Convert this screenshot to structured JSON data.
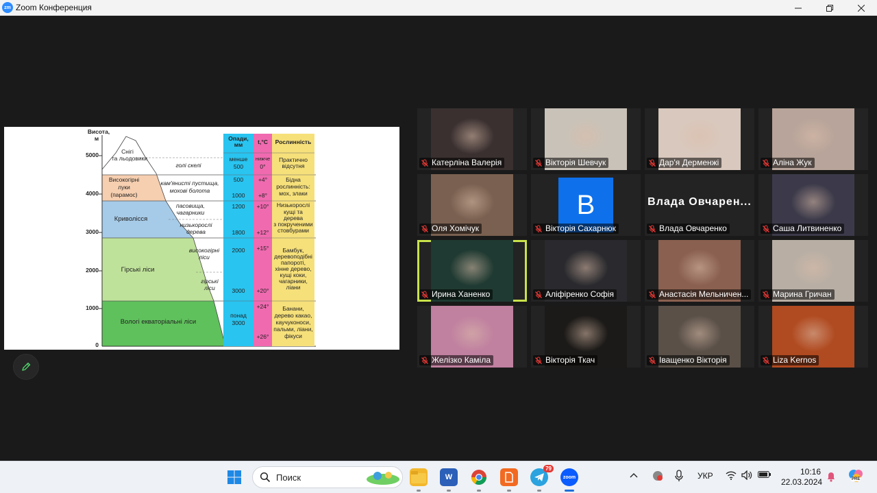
{
  "window": {
    "title": "Zoom Конференция",
    "logo_text": "zm"
  },
  "slide": {
    "height_axis_title": "Висота,",
    "height_axis_unit": "м",
    "height_ticks": [
      "5000",
      "4000",
      "3000",
      "2000",
      "1000",
      "0"
    ],
    "headers": {
      "precip": "Опади,",
      "precip_unit": "мм",
      "temp": "t,°C",
      "vegetation": "Рослинність"
    },
    "zones": [
      {
        "name": "Снігі",
        "name2": "та льодовики",
        "sub": "голі скелі",
        "precip_a": "менше",
        "precip_b": "500",
        "temp_a": "нижче",
        "temp_b": "0°",
        "veg": "Практично відсутня"
      },
      {
        "name": "Високогірні",
        "name2": "луки",
        "name3": "(парамос)",
        "sub": "кам'янисті пустища,",
        "sub2": "мохові болота",
        "precip_a": "500",
        "precip_b": "1000",
        "temp_a": "+4°",
        "temp_b": "+8°",
        "veg": "Бідна",
        "veg2": "рослинність:",
        "veg3": "мох, злаки"
      },
      {
        "name": "Криволісся",
        "sub": "пасовища,",
        "sub2": "чагарники",
        "sub3": "низькорослі",
        "sub4": "дерева",
        "precip_a": "1200",
        "precip_b": "1800",
        "temp_a": "+10°",
        "temp_b": "+12°",
        "veg": "Низькорослі",
        "veg2": "кущі та",
        "veg3": "дерева",
        "veg4": "з покрученими",
        "veg5": "стовбурами"
      },
      {
        "name": "Гірські ліси",
        "sub": "високогірні",
        "sub2": "ліси",
        "sub3": "гірські",
        "sub4": "ліси",
        "precip_a": "2000",
        "precip_b": "3000",
        "temp_a": "+15°",
        "temp_b": "+20°",
        "veg": "Бамбук,",
        "veg2": "деревоподібні",
        "veg3": "папороті,",
        "veg4": "хінне дерево,",
        "veg5": "кущі коки,",
        "veg6": "чагарники,",
        "veg7": "ліани"
      },
      {
        "name": "Вологі екваторіальні ліси",
        "precip_a": "понад",
        "precip_b": "3000",
        "temp_a": "+24°",
        "temp_b": "+26°",
        "veg": "Банани,",
        "veg2": "дерево какао,",
        "veg3": "каучуконоси,",
        "veg4": "пальми, ліани,",
        "veg5": "фікуси"
      }
    ]
  },
  "participants": [
    {
      "name": "Катерліна Валерія",
      "bg": "#3a3030",
      "active": false
    },
    {
      "name": "Вікторія Шевчук",
      "bg": "#c9c2b8",
      "active": false
    },
    {
      "name": "Дар'я Дерменжі",
      "bg": "#d9c8bd",
      "active": false
    },
    {
      "name": "Аліна Жук",
      "bg": "#b8a49a",
      "active": false
    },
    {
      "name": "Оля Хомічук",
      "bg": "#7a6050",
      "active": false
    },
    {
      "name": "Вікторія Сахарнюк",
      "bg": "#232323",
      "active": false,
      "avatar": "B"
    },
    {
      "name": "Влада Овчаренко",
      "bg": "#232323",
      "active": false,
      "bigname": "Влада Овчарен..."
    },
    {
      "name": "Саша Литвиненко",
      "bg": "#3c3a4a",
      "active": false
    },
    {
      "name": "Ирина Ханенко",
      "bg": "#1f3a32",
      "active": true
    },
    {
      "name": "Аліфіренко Софія",
      "bg": "#2a2a2e",
      "active": false
    },
    {
      "name": "Анастасія Мельничен...",
      "bg": "#8a6050",
      "active": false
    },
    {
      "name": "Марина Гричан",
      "bg": "#b8aea4",
      "active": false
    },
    {
      "name": "Желізко Каміла",
      "bg": "#c080a0",
      "active": false
    },
    {
      "name": "Вікторія Ткач",
      "bg": "#1c1a18",
      "active": false
    },
    {
      "name": "Іващенко Вікторія",
      "bg": "#5a5048",
      "active": false
    },
    {
      "name": "Liza Kernos",
      "bg": "#b04a20",
      "active": false
    }
  ],
  "taskbar": {
    "search_placeholder": "Поиск",
    "telegram_badge": "79",
    "lang": "УКР",
    "time": "10:16",
    "date": "22.03.2024",
    "zoom_label": "zoom",
    "copilot_badge": "PRE"
  },
  "colors": {
    "accent_active": "#c8e24a",
    "precip_col": "#29c4f0",
    "temp_col": "#f06ab0",
    "veg_col": "#f6e07a",
    "zone_snow": "#ffffff",
    "zone_meadow": "#f6cfb0",
    "zone_krivolissya": "#a6cbe8",
    "zone_mountain_forest": "#bfe29a",
    "zone_equatorial": "#5fc15c"
  }
}
